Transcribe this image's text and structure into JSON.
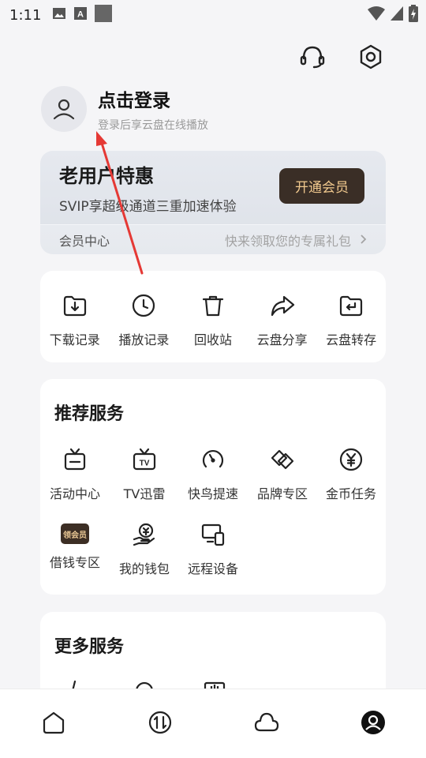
{
  "status_bar": {
    "time": "1:11"
  },
  "profile": {
    "login_title": "点击登录",
    "login_subtitle": "登录后享云盘在线播放"
  },
  "vip_card": {
    "title": "老用户特惠",
    "description": "SVIP享超级通道三重加速体验",
    "button_label": "开通会员",
    "member_center": "会员中心",
    "gift_text": "快来领取您的专属礼包"
  },
  "quick_actions": [
    {
      "label": "下载记录",
      "icon": "download-folder-icon"
    },
    {
      "label": "播放记录",
      "icon": "clock-icon"
    },
    {
      "label": "回收站",
      "icon": "trash-icon"
    },
    {
      "label": "云盘分享",
      "icon": "share-arrow-icon"
    },
    {
      "label": "云盘转存",
      "icon": "transfer-folder-icon"
    }
  ],
  "services": {
    "title": "推荐服务",
    "items": [
      {
        "label": "活动中心",
        "icon": "tv-box-icon"
      },
      {
        "label": "TV迅雷",
        "icon": "tv-icon"
      },
      {
        "label": "快鸟提速",
        "icon": "speedometer-icon"
      },
      {
        "label": "品牌专区",
        "icon": "handshake-icon"
      },
      {
        "label": "金币任务",
        "icon": "yuan-coin-icon"
      },
      {
        "label": "借钱专区",
        "icon": "loan-badge-icon",
        "badge_text": "领会员"
      },
      {
        "label": "我的钱包",
        "icon": "wallet-hand-icon"
      },
      {
        "label": "远程设备",
        "icon": "remote-device-icon"
      }
    ]
  },
  "more_services": {
    "title": "更多服务"
  },
  "bottom_nav": [
    {
      "name": "home",
      "icon": "home-icon"
    },
    {
      "name": "transfer",
      "icon": "transfer-icon"
    },
    {
      "name": "cloud",
      "icon": "cloud-icon"
    },
    {
      "name": "me",
      "icon": "profile-icon",
      "active": true
    }
  ],
  "colors": {
    "background": "#f5f5f7",
    "vip_button": "#3a2e26",
    "vip_button_text": "#f1c98e",
    "annotation_arrow": "#e53935"
  }
}
